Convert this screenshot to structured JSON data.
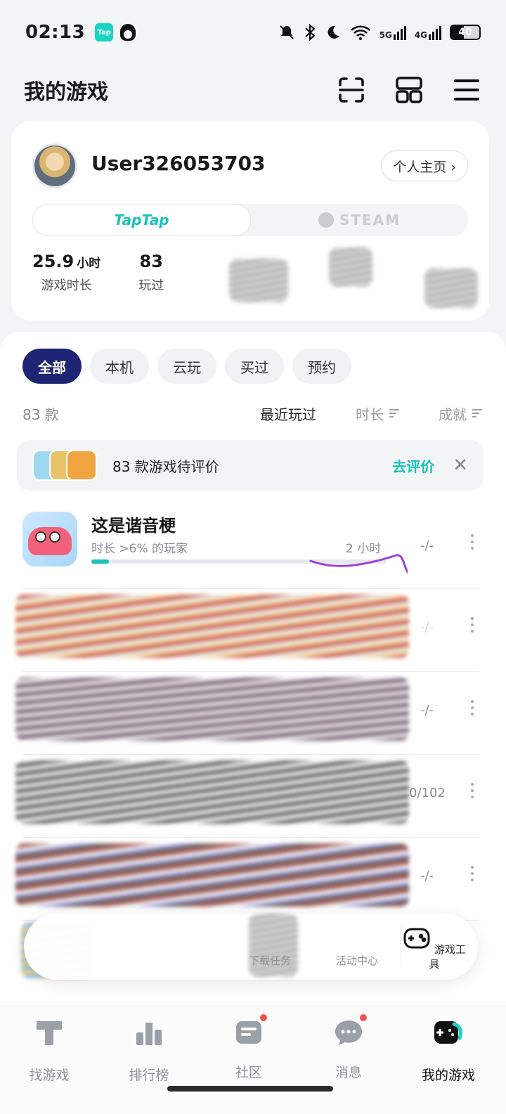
{
  "status_bar": {
    "time": "02:13",
    "app_badge": "Tap",
    "network_5g": "5G",
    "network_4g": "4G",
    "battery": "40"
  },
  "header": {
    "title": "我的游戏"
  },
  "profile": {
    "username": "User326053703",
    "profile_button": "个人主页 ›",
    "platform_tabs": [
      "TapTap",
      "STEAM"
    ],
    "stats": [
      {
        "value": "25.9",
        "unit": "小时",
        "label": "游戏时长"
      },
      {
        "value": "83",
        "unit": "",
        "label": "玩过"
      }
    ]
  },
  "filters": {
    "chips": [
      "全部",
      "本机",
      "云玩",
      "买过",
      "预约"
    ],
    "active": "全部"
  },
  "sort": {
    "count": "83 款",
    "options": [
      "最近玩过",
      "时长",
      "成就"
    ]
  },
  "review_banner": {
    "text": "83 款游戏待评价",
    "cta": "去评价",
    "close": "✕"
  },
  "games": [
    {
      "name": "这是谐音梗",
      "subtitle": "时长 >6% 的玩家",
      "hours": "2 小时",
      "progress": 0.06,
      "achievement": "-/-"
    },
    {
      "achievement": "-/-"
    },
    {
      "achievement": "-/-"
    },
    {
      "achievement": "0/102"
    },
    {
      "achievement": "-/-"
    }
  ],
  "float_toolbar": {
    "items": [
      "下载任务",
      "活动中心",
      "游戏工具"
    ]
  },
  "bottom_nav": {
    "items": [
      "找游戏",
      "排行榜",
      "社区",
      "消息",
      "我的游戏"
    ],
    "active": "我的游戏"
  },
  "colors": {
    "accent": "#19c3b6",
    "chip_active": "#1d2473",
    "badge": "#f2504f"
  },
  "icons": [
    "bell-off-icon",
    "bluetooth-icon",
    "moon-icon",
    "wifi-icon",
    "scan-icon",
    "grid-icon",
    "menu-icon",
    "chevron-right-icon",
    "close-icon",
    "kebab-icon",
    "gamepad-icon"
  ]
}
